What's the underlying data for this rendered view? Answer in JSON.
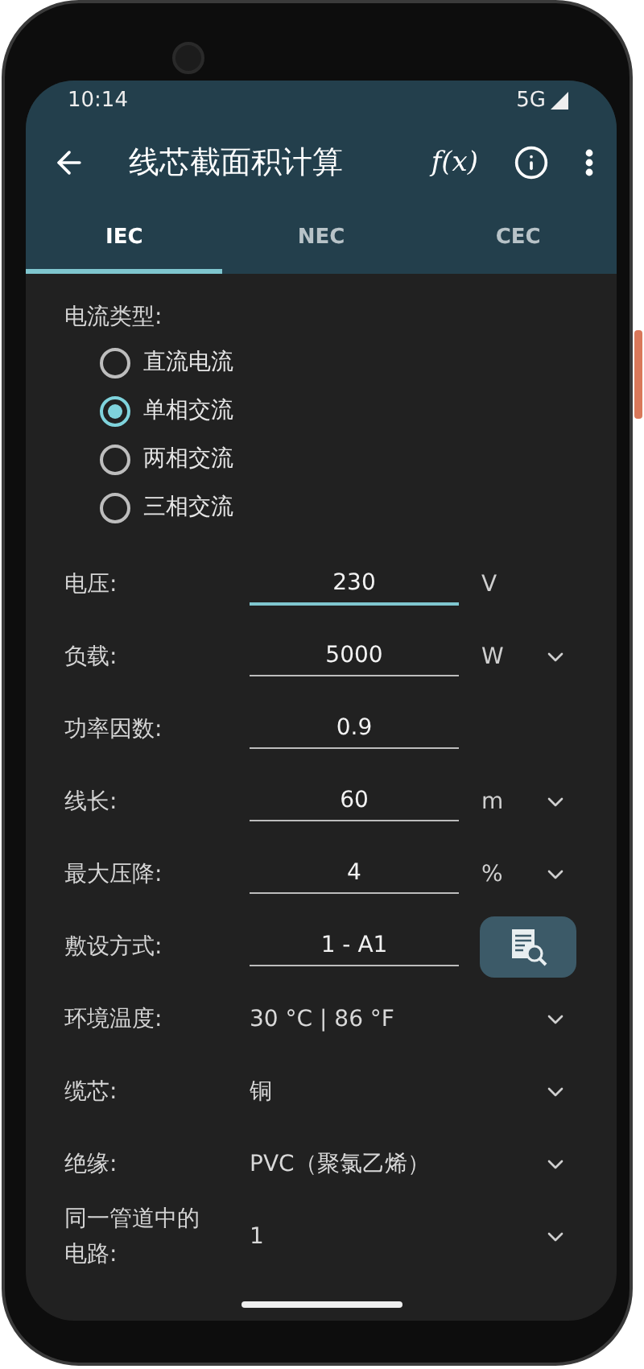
{
  "status_bar": {
    "time": "10:14",
    "network": "5G"
  },
  "app_bar": {
    "title": "线芯截面积计算",
    "formula_button": "f(x)"
  },
  "tabs": [
    {
      "label": "IEC",
      "selected": true
    },
    {
      "label": "NEC",
      "selected": false
    },
    {
      "label": "CEC",
      "selected": false
    }
  ],
  "current_type": {
    "label": "电流类型:",
    "options": [
      {
        "label": "直流电流",
        "selected": false
      },
      {
        "label": "单相交流",
        "selected": true
      },
      {
        "label": "两相交流",
        "selected": false
      },
      {
        "label": "三相交流",
        "selected": false
      }
    ]
  },
  "rows": [
    {
      "kind": "input",
      "label": "电压:",
      "value": "230",
      "unit": "V",
      "unit_menu": false,
      "focused": true
    },
    {
      "kind": "input",
      "label": "负载:",
      "value": "5000",
      "unit": "W",
      "unit_menu": true,
      "focused": false
    },
    {
      "kind": "input",
      "label": "功率因数:",
      "value": "0.9",
      "focused": false
    },
    {
      "kind": "input",
      "label": "线长:",
      "value": "60",
      "unit": "m",
      "unit_menu": true,
      "focused": false
    },
    {
      "kind": "input",
      "label": "最大压降:",
      "value": "4",
      "unit": "%",
      "unit_menu": true,
      "focused": false
    },
    {
      "kind": "lookup",
      "label": "敷设方式:",
      "value": "1 - A1",
      "focused": false
    },
    {
      "kind": "select",
      "label": "环境温度:",
      "value": "30 °C | 86 °F"
    },
    {
      "kind": "select",
      "label": "缆芯:",
      "value": "铜"
    },
    {
      "kind": "select",
      "label": "绝缘:",
      "value": "PVC（聚氯乙烯）"
    },
    {
      "kind": "select",
      "label": "同一管道中的电路:",
      "value": "1"
    }
  ]
}
